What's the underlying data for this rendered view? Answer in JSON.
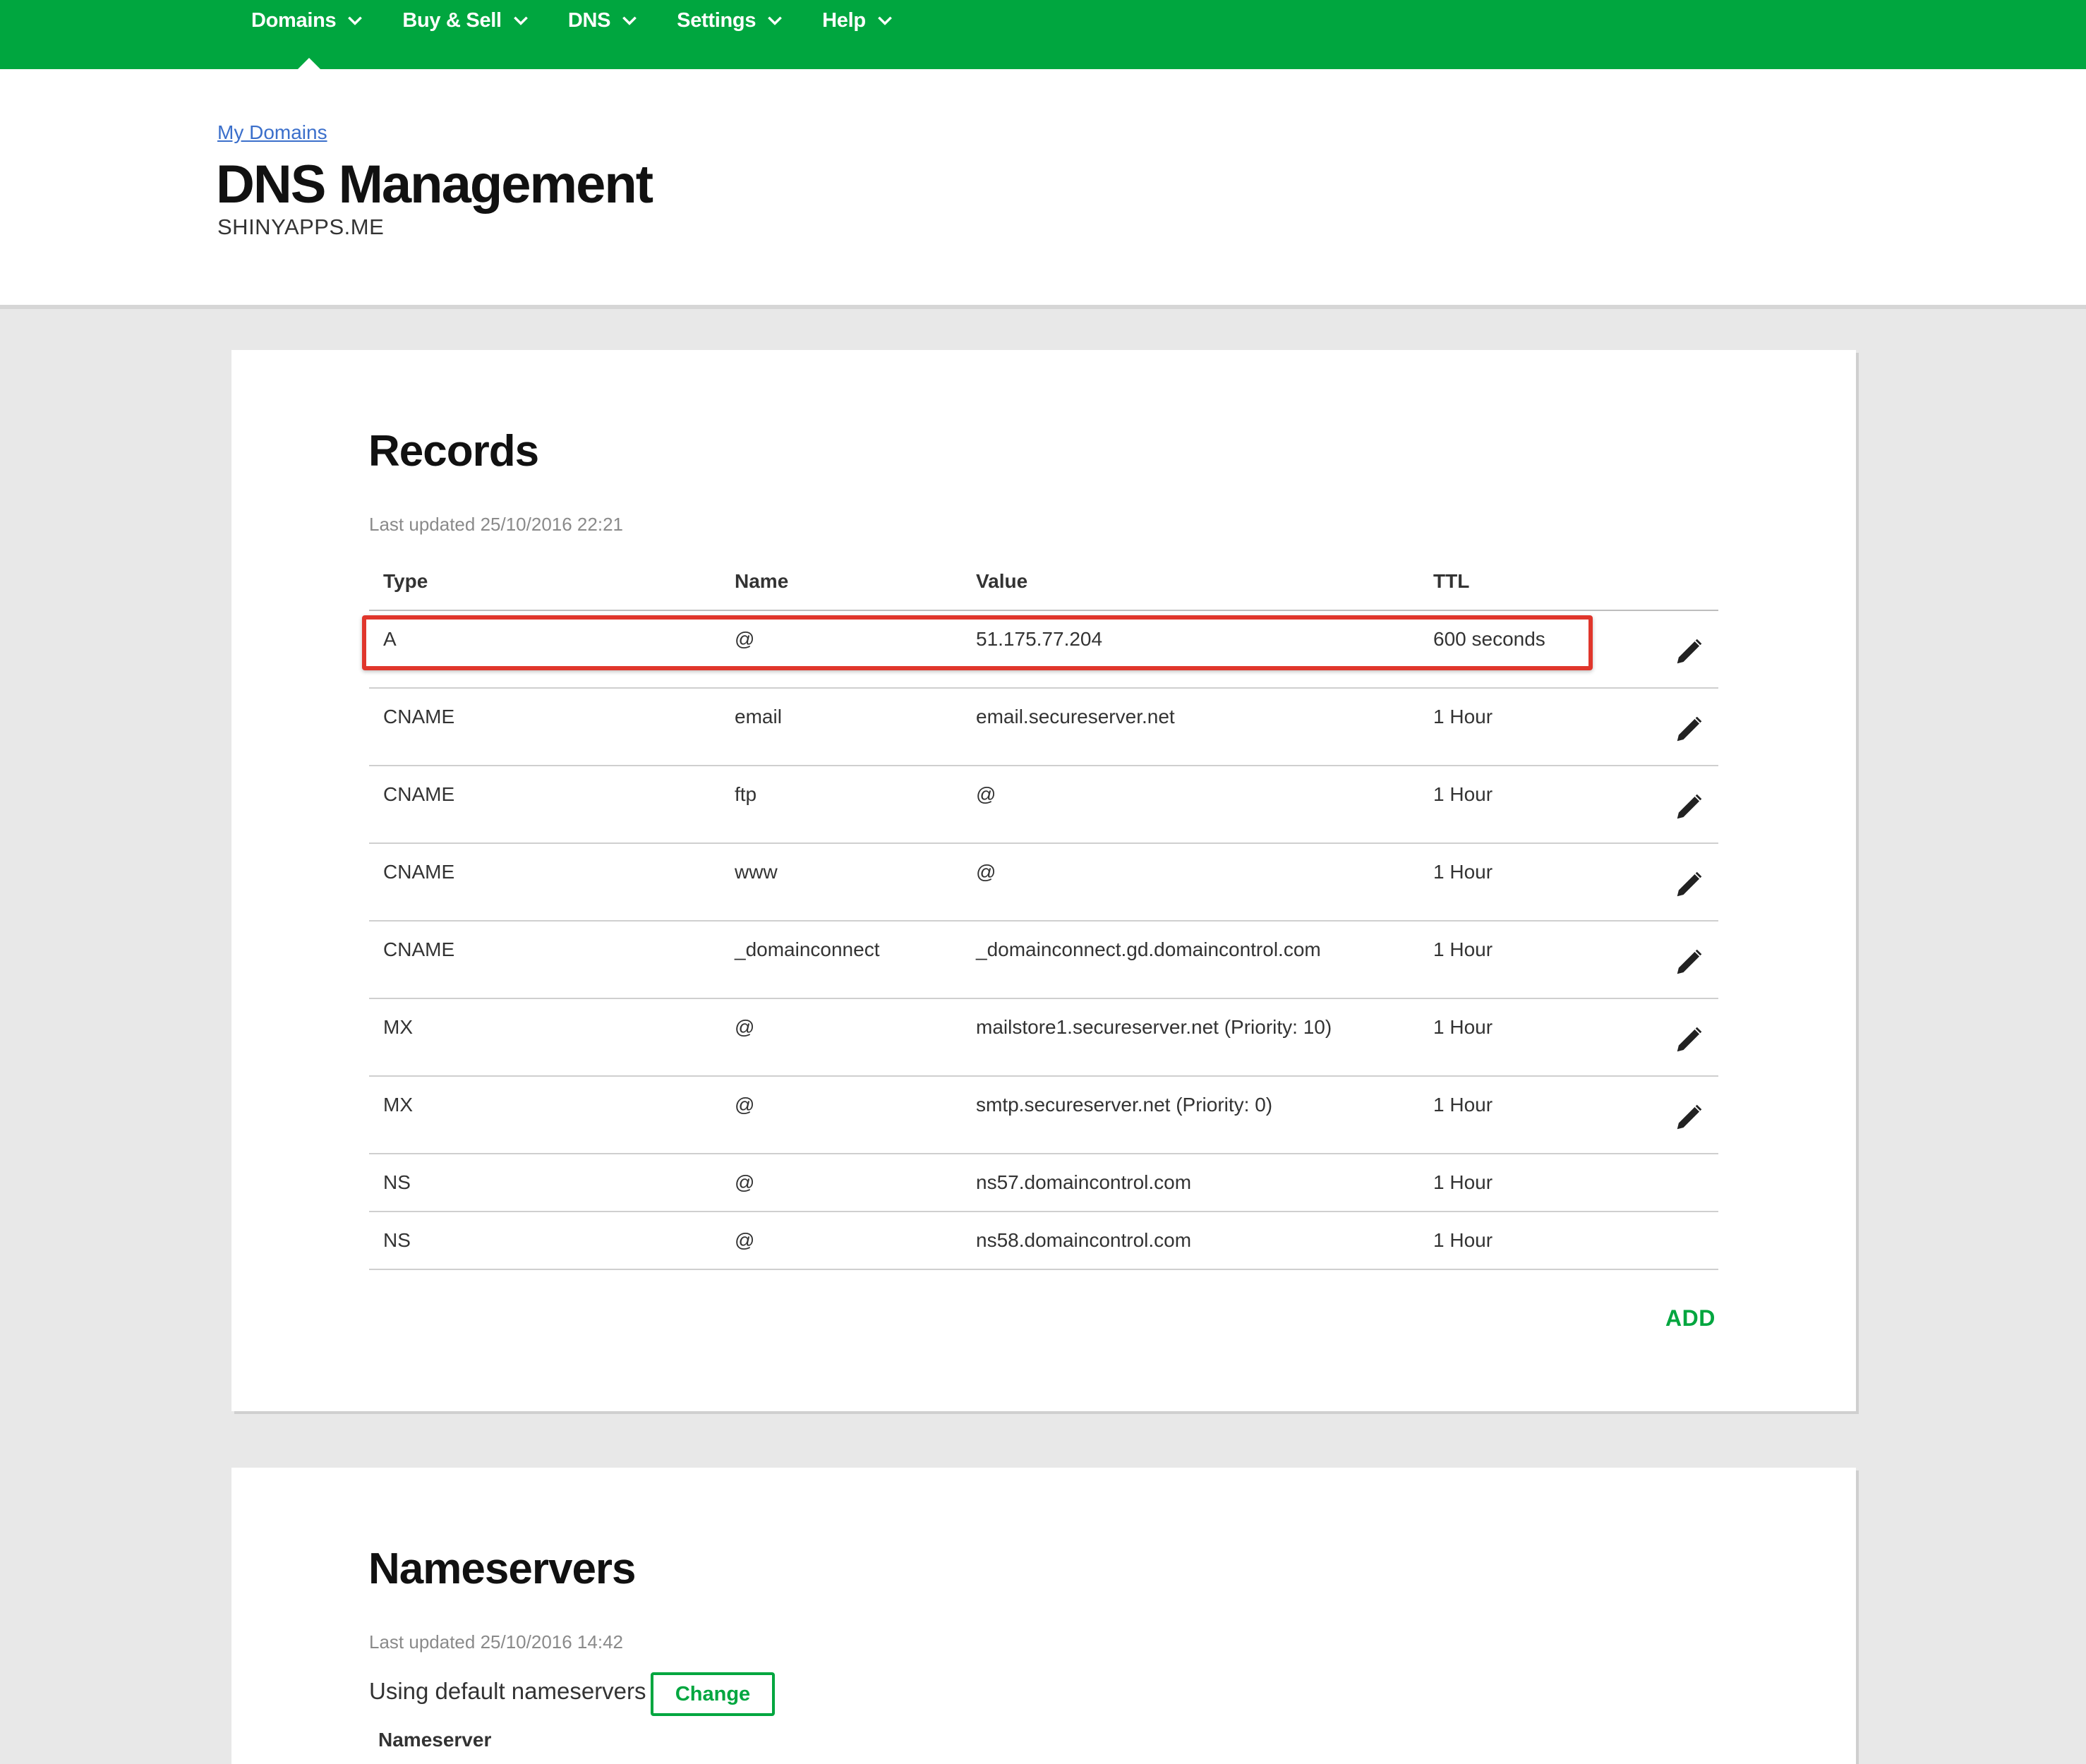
{
  "nav": {
    "items": [
      {
        "label": "Domains"
      },
      {
        "label": "Buy & Sell"
      },
      {
        "label": "DNS"
      },
      {
        "label": "Settings"
      },
      {
        "label": "Help"
      }
    ]
  },
  "header": {
    "breadcrumb": "My Domains",
    "title": "DNS Management",
    "domain": "SHINYAPPS.ME"
  },
  "records": {
    "title": "Records",
    "last_updated": "Last updated 25/10/2016 22:21",
    "columns": {
      "type": "Type",
      "name": "Name",
      "value": "Value",
      "ttl": "TTL"
    },
    "rows": [
      {
        "type": "A",
        "name": "@",
        "value": "51.175.77.204",
        "ttl": "600 seconds"
      },
      {
        "type": "CNAME",
        "name": "email",
        "value": "email.secureserver.net",
        "ttl": "1 Hour"
      },
      {
        "type": "CNAME",
        "name": "ftp",
        "value": "@",
        "ttl": "1 Hour"
      },
      {
        "type": "CNAME",
        "name": "www",
        "value": "@",
        "ttl": "1 Hour"
      },
      {
        "type": "CNAME",
        "name": "_domainconnect",
        "value": "_domainconnect.gd.domaincontrol.com",
        "ttl": "1 Hour"
      },
      {
        "type": "MX",
        "name": "@",
        "value": "mailstore1.secureserver.net (Priority: 10)",
        "ttl": "1 Hour"
      },
      {
        "type": "MX",
        "name": "@",
        "value": "smtp.secureserver.net (Priority: 0)",
        "ttl": "1 Hour"
      },
      {
        "type": "NS",
        "name": "@",
        "value": "ns57.domaincontrol.com",
        "ttl": "1 Hour"
      },
      {
        "type": "NS",
        "name": "@",
        "value": "ns58.domaincontrol.com",
        "ttl": "1 Hour"
      }
    ],
    "add_label": "ADD"
  },
  "nameservers": {
    "title": "Nameservers",
    "last_updated": "Last updated 25/10/2016 14:42",
    "using_text": "Using default nameservers",
    "change_label": "Change",
    "column_header": "Nameserver"
  },
  "colors": {
    "brand_green": "#00a63f",
    "highlight_red": "#e0362c",
    "link_blue": "#3b6fcb"
  }
}
